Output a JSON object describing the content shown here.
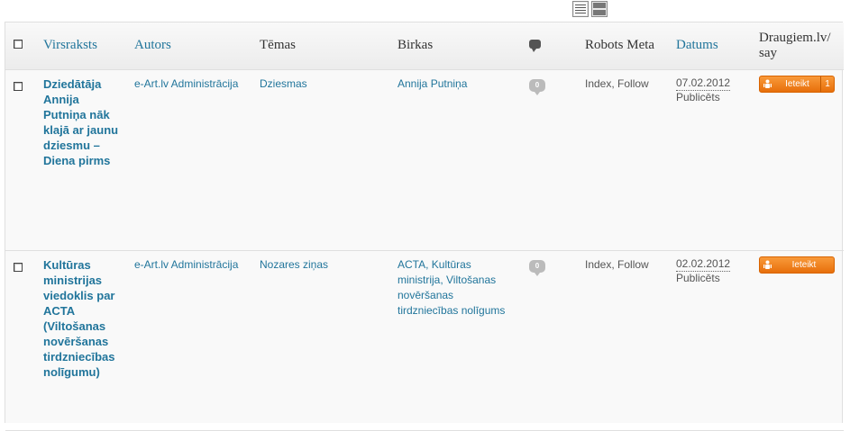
{
  "view_switch": [
    {
      "name": "list-view-icon"
    },
    {
      "name": "excerpt-view-icon"
    }
  ],
  "columns": {
    "title": "Virsraksts",
    "author": "Autors",
    "categories": "Tēmas",
    "tags": "Birkas",
    "comments_icon": "comment-bubble-icon",
    "robots": "Robots Meta",
    "date": "Datums",
    "draugiem": "Draugiem.lv/ say"
  },
  "posts": [
    {
      "title": "Dziedātāja Annija Putniņa nāk klajā ar jaunu dziesmu – Diena pirms",
      "author": "e-Art.lv Administrācija",
      "categories": "Dziesmas",
      "tags": "Annija Putniņa",
      "comments": "0",
      "robots": "Index, Follow",
      "date": "07.02.2012",
      "status": "Publicēts",
      "draugiem_label": "Ieteikt",
      "draugiem_count": "1"
    },
    {
      "title": "Kultūras ministrijas viedoklis par ACTA (Viltošanas novēršanas tirdzniecības nolīgumu)",
      "author": "e-Art.lv Administrācija",
      "categories": "Nozares ziņas",
      "tags": "ACTA, Kultūras ministrija, Viltošanas novēršanas tirdzniecības nolīgums",
      "comments": "0",
      "robots": "Index, Follow",
      "date": "02.02.2012",
      "status": "Publicēts",
      "draugiem_label": "Ieteikt",
      "draugiem_count": ""
    }
  ],
  "colors": {
    "link": "#21759b",
    "draugiem_orange": "#f4821f",
    "comment_bubble": "#bbbbbb"
  }
}
